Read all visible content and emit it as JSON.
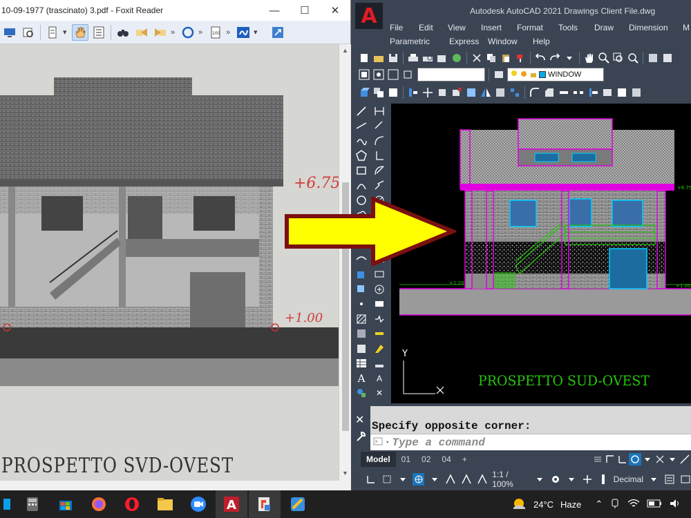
{
  "foxit": {
    "title": "10-09-1977 (trascinato) 3.pdf - Foxit Reader",
    "drawing": {
      "elev_upper": "+6.75",
      "elev_lower": "+1.00",
      "caption": "PROSPETTO  SVD-OVEST"
    }
  },
  "autocad": {
    "logo_letter": "A",
    "title": "Autodesk AutoCAD 2021   Drawings Client File.dwg",
    "menu": [
      "File",
      "Edit",
      "View",
      "Insert",
      "Format",
      "Tools",
      "Draw",
      "Dimension",
      "M",
      "Parametric",
      "Express",
      "Window",
      "Help"
    ],
    "window_combo": "WINDOW",
    "drawing": {
      "caption": "PROSPETTO SUD-OVEST",
      "level_left": "+1.20",
      "level_right": "+1.00",
      "level_top": "+6.75",
      "ucs_label": "Y"
    },
    "command": {
      "history": "Specify opposite corner:",
      "placeholder": "Type a command"
    },
    "layout_tabs": [
      "Model",
      "01",
      "02",
      "04",
      "+"
    ],
    "status": {
      "scale": "1:1 / 100%",
      "units": "Decimal"
    }
  },
  "taskbar": {
    "weather_temp": "24°C",
    "weather_desc": "Haze"
  },
  "colors": {
    "cad_magenta": "#e000e0",
    "cad_green": "#27c60c",
    "arrow_yellow": "#ffff00",
    "arrow_outline": "#7a1010"
  }
}
